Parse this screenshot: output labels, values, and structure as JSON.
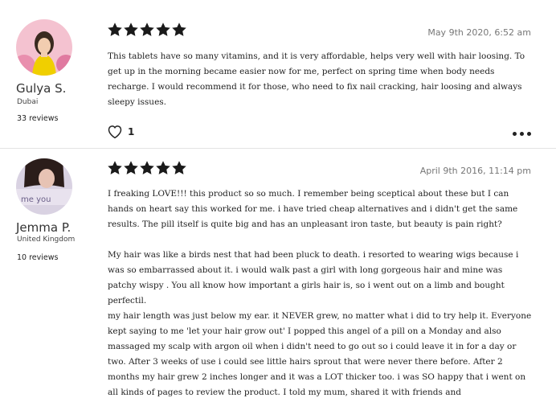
{
  "reviews": [
    {
      "author": "Gulya S.",
      "location": "Dubai",
      "review_count": "33 reviews",
      "rating": 5,
      "date": "May 9th 2020, 6:52 am",
      "paragraphs": [
        "This tablets have so many vitamins, and it is very affordable, helps  very  well with hair loosing. To get up in the morning became easier now for me, perfect on spring time when body needs recharge. I would recommend it for those, who need to fix nail cracking, hair loosing and always sleepy issues."
      ],
      "likes": "1",
      "avatar_colors": [
        "#f2b6c8",
        "#3a2a20",
        "#f0d400"
      ]
    },
    {
      "author": "Jemma P.",
      "location": "United Kingdom",
      "review_count": "10 reviews",
      "rating": 5,
      "date": "April 9th 2016, 11:14 pm",
      "paragraphs": [
        "I freaking LOVE!!! this product so so much. I remember being sceptical about these but I can hands on heart say this worked for me. i have tried cheap alternatives and i didn't get the same results. The pill itself is quite big and has an unpleasant iron taste, but beauty is pain right?",
        "",
        "My hair was like a birds nest that had been pluck to death. i resorted to wearing wigs because i was so embarrassed about it. i would walk past a girl with long gorgeous hair and mine was patchy wispy . You all know how important a girls hair is, so i went out on a limb and bought perfectil.",
        "my hair length was just below my ear. it NEVER grew, no matter what i did to try help it. Everyone kept saying to me 'let your hair grow out' I popped this angel of a pill on a Monday and also massaged my scalp with argon oil when i didn't need to go out so i could leave it in for a day or two. After 3 weeks of use i could see little hairs sprout that were never there before. After 2 months my hair grew 2 inches longer and it was a LOT thicker too. i was SO happy that i went on all kinds of pages to review the product. I told my mum, shared it with friends and"
      ],
      "avatar_colors": [
        "#c9c2d6",
        "#2b1d1a",
        "#e8dfe9"
      ],
      "avatar_overlay_text": "me you"
    }
  ],
  "icons": {
    "star": "star-icon",
    "like": "heart-icon",
    "more": "more-options-icon"
  },
  "colors": {
    "star": "#1a1a1a",
    "date": "#777777",
    "divider": "#e3e3e3"
  }
}
